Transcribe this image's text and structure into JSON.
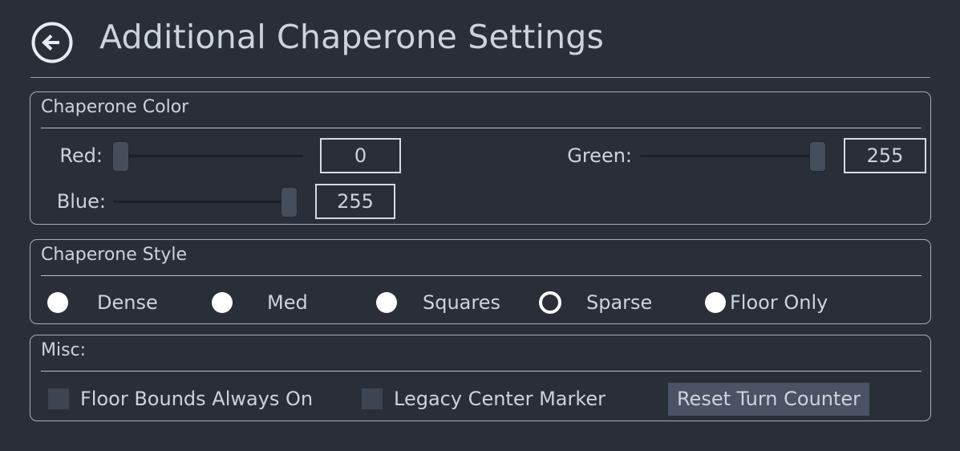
{
  "header": {
    "back_icon": "arrow-left-circle-icon",
    "title": "Additional Chaperone Settings"
  },
  "color_group": {
    "title": "Chaperone Color",
    "sliders": [
      {
        "label": "Red:",
        "value": "0",
        "min": 0,
        "max": 255,
        "percent": 0
      },
      {
        "label": "Green:",
        "value": "255",
        "min": 0,
        "max": 255,
        "percent": 100
      },
      {
        "label": "Blue:",
        "value": "255",
        "min": 0,
        "max": 255,
        "percent": 100
      }
    ]
  },
  "style_group": {
    "title": "Chaperone Style",
    "options": [
      {
        "label": "Dense",
        "selected": false
      },
      {
        "label": "Med",
        "selected": false
      },
      {
        "label": "Squares",
        "selected": false
      },
      {
        "label": "Sparse",
        "selected": true
      },
      {
        "label": "Floor Only",
        "selected": false
      }
    ]
  },
  "misc_group": {
    "title": "Misc:",
    "checkboxes": [
      {
        "label": "Floor Bounds Always On",
        "checked": false
      },
      {
        "label": "Legacy Center Marker",
        "checked": false
      }
    ],
    "reset_button": "Reset Turn Counter"
  },
  "colors": {
    "background": "#2a2e38",
    "text": "#ccd3dd",
    "border": "#a7aebb",
    "handle": "#464e5c",
    "track": "#1b1f27",
    "button": "#4a5263",
    "checkbox": "#3d4452",
    "radio_fill": "#ffffff"
  }
}
